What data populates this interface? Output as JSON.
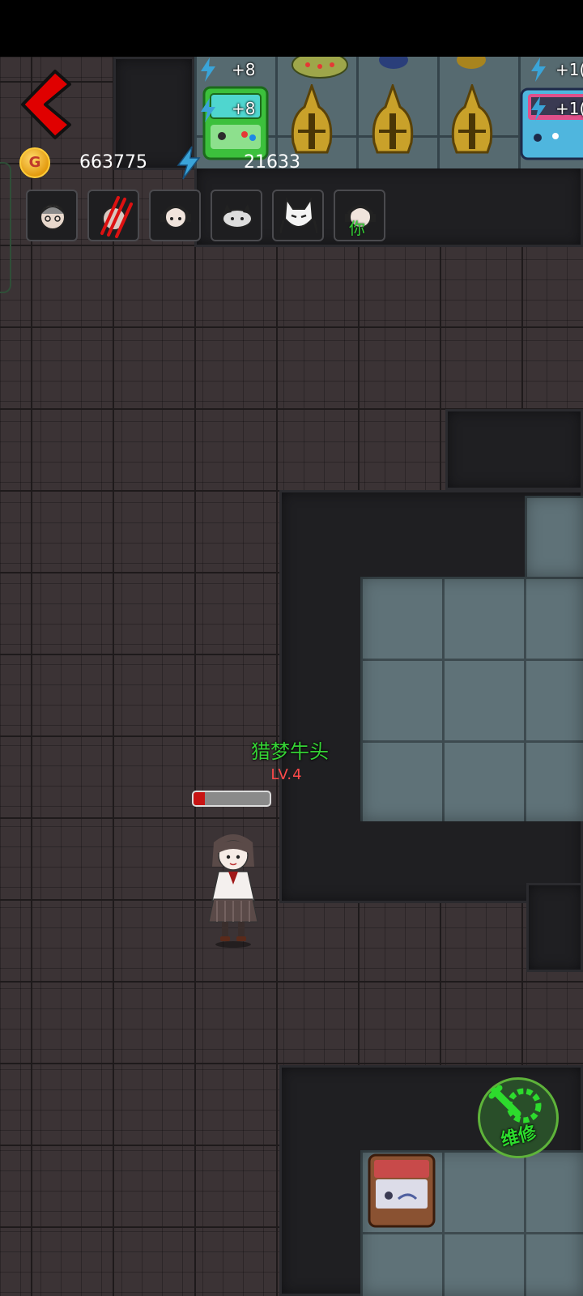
{
  "resources": {
    "gold": "663775",
    "energy": "21633",
    "gold_icon_letter": "G"
  },
  "shop": {
    "badges": [
      "+8",
      "+8",
      "+1(",
      "+1("
    ]
  },
  "player": {
    "name": "猎梦牛头",
    "level": "LV.4",
    "hp_fraction": 0.15
  },
  "avatars": [
    {
      "icon": "grandma-avatar-icon"
    },
    {
      "icon": "scratched-avatar-icon"
    },
    {
      "icon": "girl-headphones-avatar-icon"
    },
    {
      "icon": "cat-face-avatar-icon"
    },
    {
      "icon": "fox-mask-avatar-icon"
    },
    {
      "icon": "girl-headphones-you-avatar-icon",
      "tag": "你"
    }
  ],
  "repair_button": {
    "label": "维修"
  },
  "colors": {
    "name_green": "#35d335",
    "level_red": "#ff4a4a",
    "repair_green": "#2ddb2d",
    "arrow_red": "#e00000"
  }
}
